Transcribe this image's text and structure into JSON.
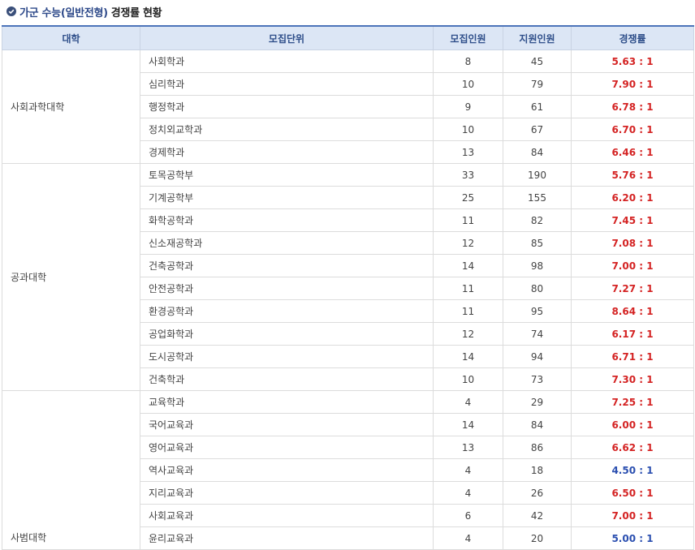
{
  "title": {
    "part1": "가군 수능(일반전형)",
    "part2": "경쟁률 현황"
  },
  "colors": {
    "high_rate": "#d42323",
    "low_rate": "#2b4fb0",
    "header_bg": "#dce6f5",
    "accent": "#4c74b9"
  },
  "icon": "check-circle-icon",
  "table": {
    "headers": [
      "대학",
      "모집단위",
      "모집인원",
      "지원인원",
      "경쟁률"
    ],
    "groups": [
      {
        "college": "사회과학대학",
        "rows": [
          {
            "unit": "사회학과",
            "quota": "8",
            "applicants": "45",
            "rate": "5.63 : 1",
            "tone": "hi"
          },
          {
            "unit": "심리학과",
            "quota": "10",
            "applicants": "79",
            "rate": "7.90 : 1",
            "tone": "hi"
          },
          {
            "unit": "행정학과",
            "quota": "9",
            "applicants": "61",
            "rate": "6.78 : 1",
            "tone": "hi"
          },
          {
            "unit": "정치외교학과",
            "quota": "10",
            "applicants": "67",
            "rate": "6.70 : 1",
            "tone": "hi"
          },
          {
            "unit": "경제학과",
            "quota": "13",
            "applicants": "84",
            "rate": "6.46 : 1",
            "tone": "hi"
          }
        ]
      },
      {
        "college": "공과대학",
        "rows": [
          {
            "unit": "토목공학부",
            "quota": "33",
            "applicants": "190",
            "rate": "5.76 : 1",
            "tone": "hi"
          },
          {
            "unit": "기계공학부",
            "quota": "25",
            "applicants": "155",
            "rate": "6.20 : 1",
            "tone": "hi"
          },
          {
            "unit": "화학공학과",
            "quota": "11",
            "applicants": "82",
            "rate": "7.45 : 1",
            "tone": "hi"
          },
          {
            "unit": "신소재공학과",
            "quota": "12",
            "applicants": "85",
            "rate": "7.08 : 1",
            "tone": "hi"
          },
          {
            "unit": "건축공학과",
            "quota": "14",
            "applicants": "98",
            "rate": "7.00 : 1",
            "tone": "hi"
          },
          {
            "unit": "안전공학과",
            "quota": "11",
            "applicants": "80",
            "rate": "7.27 : 1",
            "tone": "hi"
          },
          {
            "unit": "환경공학과",
            "quota": "11",
            "applicants": "95",
            "rate": "8.64 : 1",
            "tone": "hi"
          },
          {
            "unit": "공업화학과",
            "quota": "12",
            "applicants": "74",
            "rate": "6.17 : 1",
            "tone": "hi"
          },
          {
            "unit": "도시공학과",
            "quota": "14",
            "applicants": "94",
            "rate": "6.71 : 1",
            "tone": "hi"
          },
          {
            "unit": "건축학과",
            "quota": "10",
            "applicants": "73",
            "rate": "7.30 : 1",
            "tone": "hi"
          }
        ]
      },
      {
        "college": "사범대학",
        "rows": [
          {
            "unit": "교육학과",
            "quota": "4",
            "applicants": "29",
            "rate": "7.25 : 1",
            "tone": "hi"
          },
          {
            "unit": "국어교육과",
            "quota": "14",
            "applicants": "84",
            "rate": "6.00 : 1",
            "tone": "hi"
          },
          {
            "unit": "영어교육과",
            "quota": "13",
            "applicants": "86",
            "rate": "6.62 : 1",
            "tone": "hi"
          },
          {
            "unit": "역사교육과",
            "quota": "4",
            "applicants": "18",
            "rate": "4.50 : 1",
            "tone": "lo"
          },
          {
            "unit": "지리교육과",
            "quota": "4",
            "applicants": "26",
            "rate": "6.50 : 1",
            "tone": "hi"
          },
          {
            "unit": "사회교육과",
            "quota": "6",
            "applicants": "42",
            "rate": "7.00 : 1",
            "tone": "hi"
          },
          {
            "unit": "윤리교육과",
            "quota": "4",
            "applicants": "20",
            "rate": "5.00 : 1",
            "tone": "lo"
          }
        ]
      }
    ]
  }
}
